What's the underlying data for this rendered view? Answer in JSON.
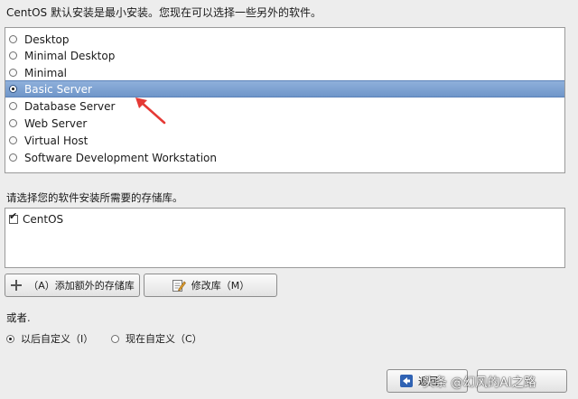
{
  "intro_text": "CentOS 默认安装是最小安装。您现在可以选择一些另外的软件。",
  "install_options": [
    {
      "label": "Desktop",
      "selected": false
    },
    {
      "label": "Minimal Desktop",
      "selected": false
    },
    {
      "label": "Minimal",
      "selected": false
    },
    {
      "label": "Basic Server",
      "selected": true
    },
    {
      "label": "Database Server",
      "selected": false
    },
    {
      "label": "Web Server",
      "selected": false
    },
    {
      "label": "Virtual Host",
      "selected": false
    },
    {
      "label": "Software Development Workstation",
      "selected": false
    }
  ],
  "repo_caption": "请选择您的软件安装所需要的存储库。",
  "repositories": [
    {
      "label": "CentOS",
      "checked": true
    }
  ],
  "buttons": {
    "add_repo": "（A）添加额外的存储库",
    "edit_repo": "修改库（M）",
    "back": "返回",
    "next": ""
  },
  "or_label": "或者.",
  "customize": {
    "later": "以后自定义（I）",
    "now": "现在自定义（C）",
    "selected": "later"
  },
  "watermark": "头条 @幻风的AI之路",
  "colors": {
    "selection": "#7aa0d2",
    "arrow": "#e53935"
  }
}
